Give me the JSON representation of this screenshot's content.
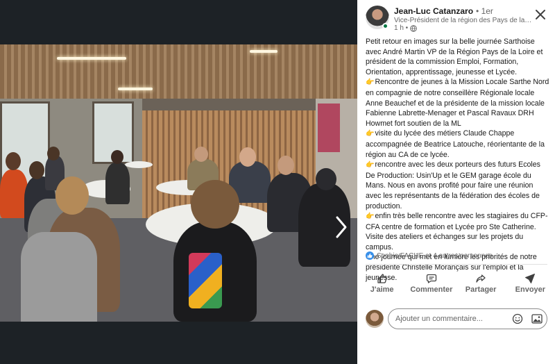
{
  "author": {
    "name": "Jean-Luc Catanzaro",
    "degree": "• 1er",
    "headline": "Vice-Président de la région des Pays de la Loire/C...",
    "time": "1 h •"
  },
  "post": {
    "lines": [
      "Petit retour en images sur la belle journée Sarthoise avec André Martin VP de la Région Pays de la Loire et président de la commission Emploi, Formation, Orientation, apprentissage, jeunesse et Lycée.",
      "Rencontre de jeunes à la Mission Locale Sarthe Nord en compagnie de notre conseillère Régionale locale Anne Beauchef et de la présidente de la mission locale Fabienne Labrette-Menager et Pascal Ravaux DRH Howmet fort soutien de la ML",
      "visite du lycée des métiers Claude Chappe accompagnée de Beatrice Latouche, réorientante de la région au CA de ce lycée.",
      "rencontre avec les deux porteurs des futurs Ecoles De Production: Usin'Up et le GEM garage école du Mans. Nous en avons profité pour faire une réunion avec les représentants de la fédération des écoles de production.",
      "enfin très belle rencontre avec les stagiaires du CFP-CFA centre de formation et Lycée pro Ste Catherine. Visite des ateliers et échanges sur les projets du campus.",
      "Une journée qui met en lumière les priorités de notre présidente Christelle Morançais sur l'emploi et la jeunesse."
    ]
  },
  "reactions": {
    "text": "Sophie FACHE et 4 autres personnes"
  },
  "actions": [
    {
      "label": "J'aime",
      "icon": "like-icon"
    },
    {
      "label": "Commenter",
      "icon": "comment-icon"
    },
    {
      "label": "Partager",
      "icon": "share-icon"
    },
    {
      "label": "Envoyer",
      "icon": "send-icon"
    }
  ],
  "comment": {
    "placeholder": "Ajouter un commentaire..."
  },
  "colors": {
    "accent": "#378fe9",
    "presence": "#057642",
    "viewer_bg": "#1d2226"
  }
}
